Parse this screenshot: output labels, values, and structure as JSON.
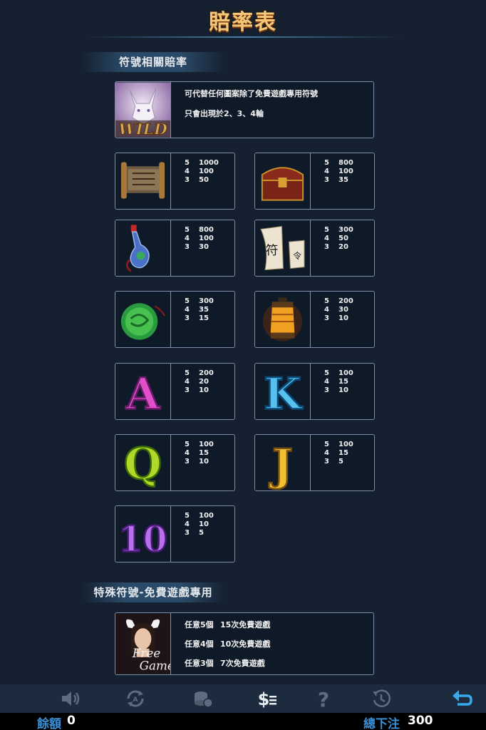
{
  "page": {
    "title": "賠率表"
  },
  "sections": {
    "symbol_odds": "符號相關賠率",
    "special_symbols": "特殊符號-免費遊戲專用"
  },
  "wild": {
    "icon": "wild-fox-icon",
    "icon_text": "WILD",
    "line1": "可代替任何圖案除了免費遊戲專用符號",
    "line2": "只會出現於2、3、4輪"
  },
  "symbols": [
    {
      "icon": "scroll-icon",
      "pays": [
        [
          "5",
          "1000"
        ],
        [
          "4",
          "100"
        ],
        [
          "3",
          "50"
        ]
      ]
    },
    {
      "icon": "treasure-chest-icon",
      "pays": [
        [
          "5",
          "800"
        ],
        [
          "4",
          "100"
        ],
        [
          "3",
          "35"
        ]
      ]
    },
    {
      "icon": "potion-bottle-icon",
      "pays": [
        [
          "5",
          "800"
        ],
        [
          "4",
          "100"
        ],
        [
          "3",
          "30"
        ]
      ]
    },
    {
      "icon": "talisman-icon",
      "pays": [
        [
          "5",
          "300"
        ],
        [
          "4",
          "50"
        ],
        [
          "3",
          "20"
        ]
      ]
    },
    {
      "icon": "jade-orb-icon",
      "pays": [
        [
          "5",
          "300"
        ],
        [
          "4",
          "35"
        ],
        [
          "3",
          "15"
        ]
      ]
    },
    {
      "icon": "lantern-icon",
      "pays": [
        [
          "5",
          "200"
        ],
        [
          "4",
          "30"
        ],
        [
          "3",
          "10"
        ]
      ]
    },
    {
      "icon": "letter-a-icon",
      "letter": "A",
      "pays": [
        [
          "5",
          "200"
        ],
        [
          "4",
          "20"
        ],
        [
          "3",
          "10"
        ]
      ]
    },
    {
      "icon": "letter-k-icon",
      "letter": "K",
      "pays": [
        [
          "5",
          "100"
        ],
        [
          "4",
          "15"
        ],
        [
          "3",
          "10"
        ]
      ]
    },
    {
      "icon": "letter-q-icon",
      "letter": "Q",
      "pays": [
        [
          "5",
          "100"
        ],
        [
          "4",
          "15"
        ],
        [
          "3",
          "10"
        ]
      ]
    },
    {
      "icon": "letter-j-icon",
      "letter": "J",
      "pays": [
        [
          "5",
          "100"
        ],
        [
          "4",
          "15"
        ],
        [
          "3",
          "5"
        ]
      ]
    },
    {
      "icon": "number-10-icon",
      "letter": "10",
      "pays": [
        [
          "5",
          "100"
        ],
        [
          "4",
          "10"
        ],
        [
          "3",
          "5"
        ]
      ]
    }
  ],
  "free_game": {
    "icon": "free-game-girl-icon",
    "icon_text1": "Free",
    "icon_text2": "Game",
    "rows": [
      {
        "count": "任意5個",
        "reward": "15次免費遊戲"
      },
      {
        "count": "任意4個",
        "reward": "10次免費遊戲"
      },
      {
        "count": "任意3個",
        "reward": "7次免費遊戲"
      }
    ]
  },
  "toolbar": {
    "buttons": [
      "sound-icon",
      "autospin-icon",
      "bet-chips-icon",
      "paytable-icon",
      "help-icon",
      "history-icon",
      "back-arrow-icon"
    ]
  },
  "status": {
    "balance_label": "餘額",
    "balance_value": "0",
    "total_bet_label": "總下注",
    "total_bet_value": "300"
  },
  "colors": {
    "background": "#152130",
    "title": "#f5c878",
    "card_border": "#7c8fa8",
    "status_label": "#3a8fd6"
  }
}
